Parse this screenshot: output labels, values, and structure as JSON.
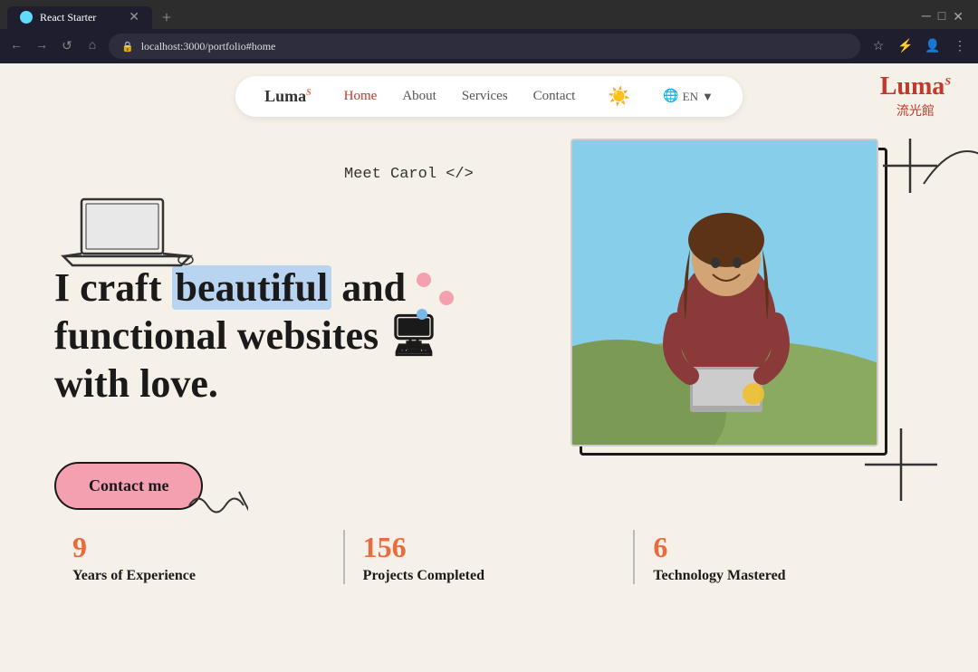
{
  "browser": {
    "tab_title": "React Starter",
    "url": "localhost:3000/portfolio#home",
    "new_tab_label": "+"
  },
  "navbar": {
    "logo": "Luma",
    "logo_sup": "S",
    "links": [
      {
        "label": "Home",
        "active": true
      },
      {
        "label": "About",
        "active": false
      },
      {
        "label": "Services",
        "active": false
      },
      {
        "label": "Contact",
        "active": false
      }
    ],
    "lang": "EN",
    "lang_dropdown": "▼"
  },
  "watermark": {
    "name": "Luma",
    "sup": "S",
    "sub": "流光館"
  },
  "hero": {
    "meet_text": "Meet Carol </>",
    "headline_part1": "I craft ",
    "headline_highlight": "beautiful",
    "headline_part2": " and functional websites 🖥 with love.",
    "contact_button": "Contact me"
  },
  "stats": [
    {
      "number": "9",
      "label": "Years of Experience"
    },
    {
      "number": "156",
      "label": "Projects Completed"
    },
    {
      "number": "6",
      "label": "Technology Mastered"
    }
  ]
}
